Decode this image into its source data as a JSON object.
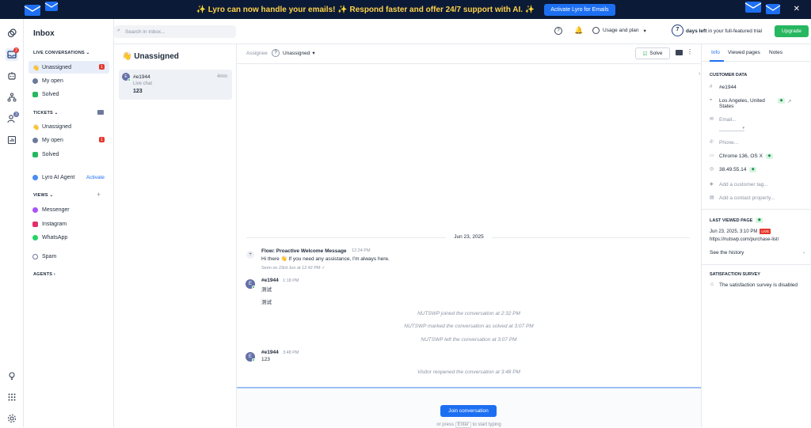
{
  "banner": {
    "text": "✨ Lyro can now handle your emails! ✨ Respond faster and offer 24/7 support with AI. ✨",
    "button": "Activate Lyro for Emails"
  },
  "rail": {
    "inbox_badge": "2",
    "contacts_badge": "3"
  },
  "sidebar": {
    "title": "Inbox",
    "live_header": "LIVE CONVERSATIONS",
    "live_items": [
      {
        "label": "Unassigned",
        "badge": "1"
      },
      {
        "label": "My open"
      },
      {
        "label": "Solved"
      }
    ],
    "tickets_header": "TICKETS",
    "ticket_items": [
      {
        "label": "Unassigned"
      },
      {
        "label": "My open",
        "badge": "1"
      },
      {
        "label": "Solved"
      }
    ],
    "lyro_label": "Lyro AI Agent",
    "lyro_action": "Activate",
    "views_header": "VIEWS",
    "views": [
      "Messenger",
      "Instagram",
      "WhatsApp"
    ],
    "spam": "Spam",
    "agents_header": "AGENTS"
  },
  "topbar": {
    "search_placeholder": "Search in Inbox...",
    "usage": "Usage and plan",
    "days": "7",
    "days_text_bold": "days left",
    "days_text": " in your full-featured trial",
    "upgrade": "Upgrade"
  },
  "list": {
    "title": "Unassigned",
    "item": {
      "name": "#e1944",
      "time": "4min",
      "channel": "Live chat",
      "preview": "123"
    }
  },
  "conversation": {
    "assignee_label": "Assignee",
    "assignee_value": "Unassigned",
    "solve": "Solve",
    "date": "Jun 23, 2025",
    "flow_name": "Flow: Proactive Welcome Message",
    "flow_time": "12:24 PM",
    "flow_text": "Hi there 👋 If you need any assistance, I'm always here.",
    "flow_seen": "Seen on 23rd Jun at 12:42 PM",
    "msg1_name": "#e1944",
    "msg1_time": "1:18 PM",
    "msg1_line1": "测试",
    "msg1_line2": "测试",
    "sys1": "NUTSWP joined the conversation at 2:32 PM",
    "sys2": "NUTSWP marked the conversation as solved at 3:07 PM",
    "sys3": "NUTSWP left the conversation at 3:07 PM",
    "msg2_name": "#e1944",
    "msg2_time": "3:48 PM",
    "msg2_text": "123",
    "sys4": "Visitor reopened the conversation at 3:48 PM",
    "avatar_letter": "E",
    "join": "Join conversation",
    "footer_hint_pre": "or press",
    "footer_hint_key": "Enter",
    "footer_hint_post": "to start typing"
  },
  "info": {
    "tabs": [
      "Info",
      "Viewed pages",
      "Notes"
    ],
    "customer_header": "CUSTOMER DATA",
    "id": "#e1944",
    "location": "Los Angeles, United States",
    "email_placeholder": "Email...",
    "phone_placeholder": "Phone...",
    "browser": "Chrome 136, OS X",
    "ip": "38.49.55.14",
    "tag_placeholder": "Add a customer tag...",
    "property_placeholder": "Add a contact property...",
    "last_header": "LAST VIEWED PAGE",
    "last_time": "Jun 23, 2025, 3:10 PM",
    "live": "LIVE",
    "last_url": "https://nutswp.com/purchase-list/",
    "history": "See the history",
    "survey_header": "SATISFACTION SURVEY",
    "survey_text": "The satisfaction survey is disabled"
  },
  "colors": {
    "accent": "#1d6ff2",
    "upgrade": "#27b760",
    "badge": "#e5372d",
    "banner_bg": "#0b1a36"
  }
}
